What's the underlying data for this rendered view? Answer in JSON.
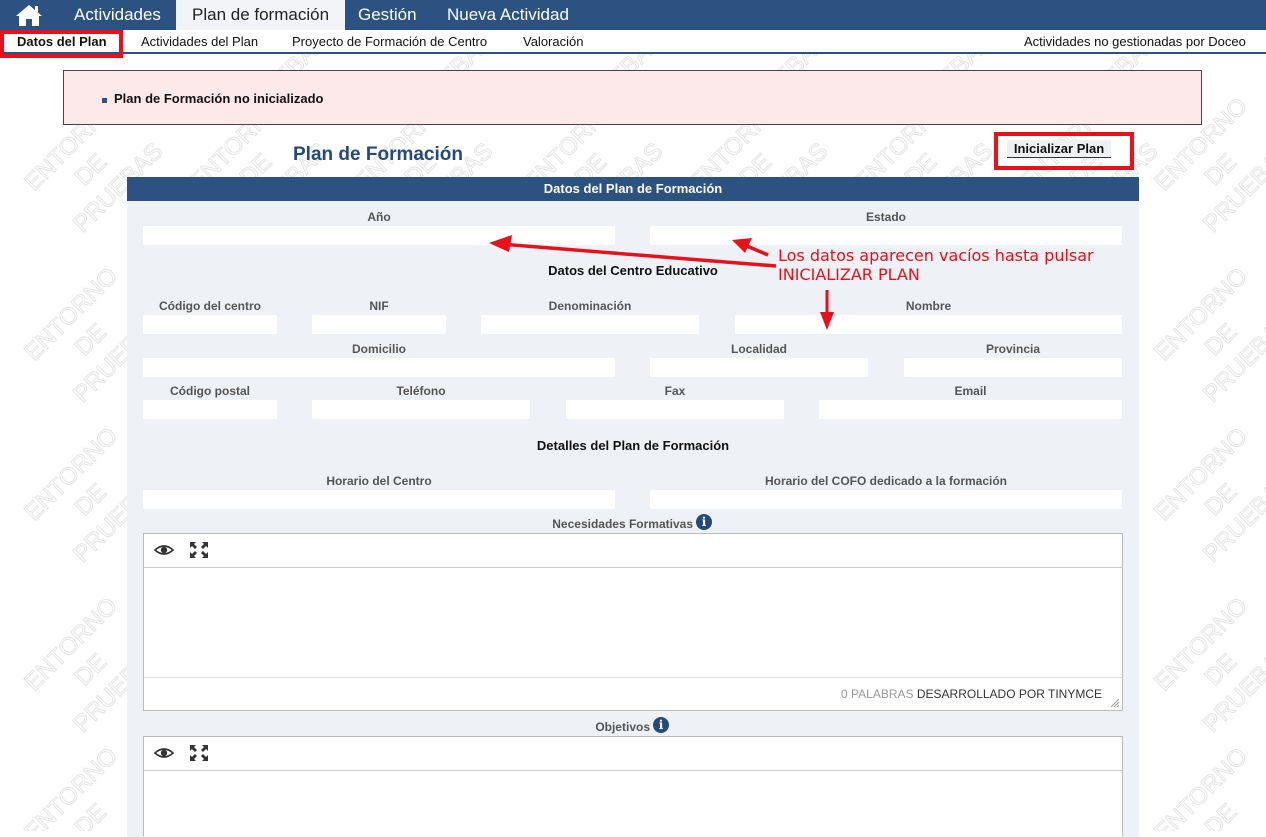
{
  "watermark": {
    "line1": "ENTORNO",
    "line2": "DE",
    "line3": "PRUEBAS"
  },
  "topnav": {
    "home_icon": "home-icon",
    "tabs": [
      {
        "label": "Actividades"
      },
      {
        "label": "Plan de formación",
        "active": true
      },
      {
        "label": "Gestión"
      },
      {
        "label": "Nueva Actividad"
      }
    ]
  },
  "subnav": {
    "items": [
      {
        "label": "Datos del Plan",
        "active": true
      },
      {
        "label": "Actividades del Plan"
      },
      {
        "label": "Proyecto de Formación de Centro"
      },
      {
        "label": "Valoración"
      }
    ],
    "right_item": "Actividades no gestionadas por Doceo"
  },
  "alert": {
    "message": "Plan de Formación no inicializado"
  },
  "page": {
    "title": "Plan de Formación",
    "init_button": "Inicializar Plan"
  },
  "panel": {
    "header": "Datos del Plan de Formación"
  },
  "plan": {
    "anio_label": "Año",
    "anio_value": "",
    "estado_label": "Estado",
    "estado_value": ""
  },
  "centro": {
    "section_title": "Datos del Centro Educativo",
    "codigo_label": "Código del centro",
    "codigo_value": "",
    "nif_label": "NIF",
    "nif_value": "",
    "denominacion_label": "Denominación",
    "denominacion_value": "",
    "nombre_label": "Nombre",
    "nombre_value": "",
    "domicilio_label": "Domicilio",
    "domicilio_value": "",
    "localidad_label": "Localidad",
    "localidad_value": "",
    "provincia_label": "Provincia",
    "provincia_value": "",
    "cp_label": "Código postal",
    "cp_value": "",
    "telefono_label": "Teléfono",
    "telefono_value": "",
    "fax_label": "Fax",
    "fax_value": "",
    "email_label": "Email",
    "email_value": ""
  },
  "detalles": {
    "section_title": "Detalles del Plan de Formación",
    "horario_centro_label": "Horario del Centro",
    "horario_centro_value": "",
    "horario_cofo_label": "Horario del COFO dedicado a la formación",
    "horario_cofo_value": ""
  },
  "necesidades": {
    "label": "Necesidades Formativas",
    "info_icon": "info-icon",
    "toolbar": [
      "eye-icon",
      "fullscreen-icon"
    ],
    "word_count": "0 PALABRAS",
    "powered_by": "DESARROLLADO POR TINYMCE"
  },
  "objetivos": {
    "label": "Objetivos",
    "info_icon": "info-icon",
    "toolbar": [
      "eye-icon",
      "fullscreen-icon"
    ]
  },
  "annotation": {
    "line1": "Los datos aparecen vacíos hasta pulsar",
    "line2": "INICIALIZAR PLAN",
    "color": "#e8101a"
  }
}
